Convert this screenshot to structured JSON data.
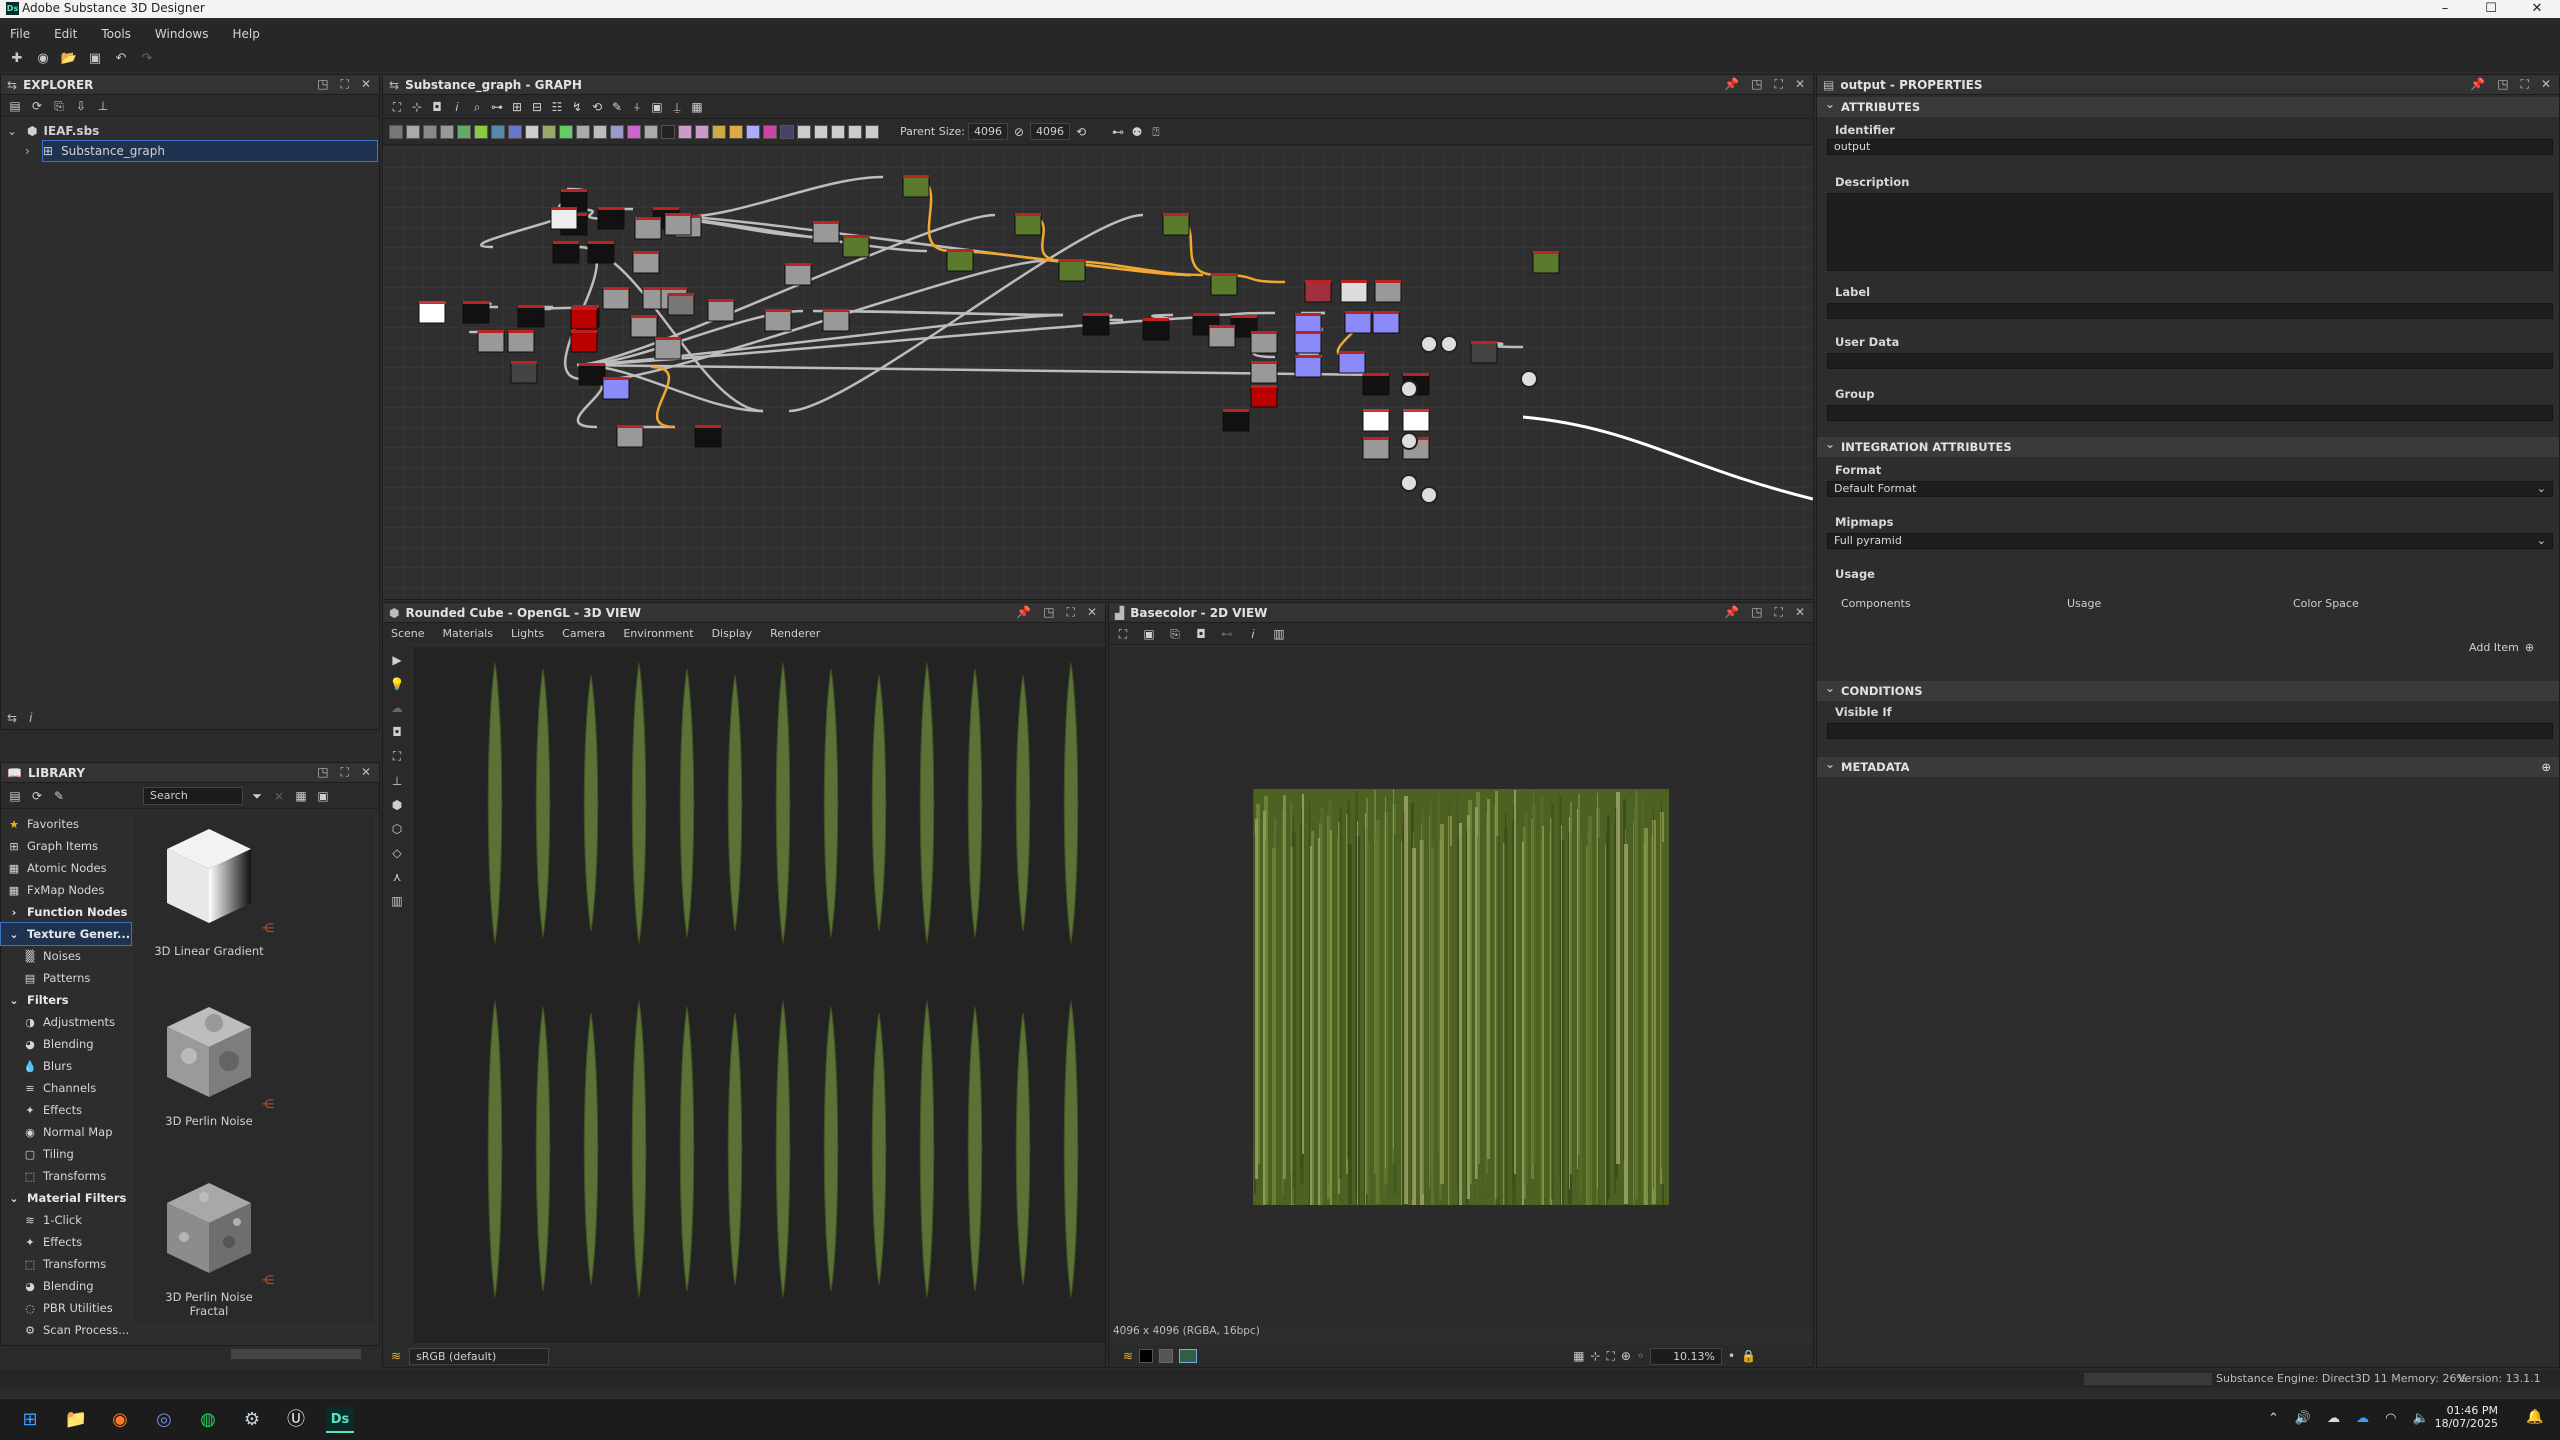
{
  "app": {
    "title": "Adobe Substance 3D Designer",
    "logo": "Ds"
  },
  "menu": [
    "File",
    "Edit",
    "Tools",
    "Windows",
    "Help"
  ],
  "explorer": {
    "title": "EXPLORER",
    "package": "IEAF.sbs",
    "graph": "Substance_graph"
  },
  "library": {
    "title": "LIBRARY",
    "search_placeholder": "Search",
    "categories": [
      {
        "label": "Favorites",
        "bold": false,
        "indent": 0,
        "icon": "star-icon"
      },
      {
        "label": "Graph Items",
        "bold": false,
        "indent": 0,
        "icon": "graph-icon"
      },
      {
        "label": "Atomic Nodes",
        "bold": false,
        "indent": 0,
        "icon": "grid-icon"
      },
      {
        "label": "FxMap Nodes",
        "bold": false,
        "indent": 0,
        "icon": "grid-icon"
      },
      {
        "label": "Function Nodes",
        "bold": true,
        "indent": 0,
        "icon": "chevron-right-icon"
      },
      {
        "label": "Texture Gener...",
        "bold": true,
        "indent": 0,
        "icon": "chevron-down-icon"
      },
      {
        "label": "Noises",
        "bold": false,
        "indent": 1,
        "icon": "noise-icon"
      },
      {
        "label": "Patterns",
        "bold": false,
        "indent": 1,
        "icon": "pattern-icon"
      },
      {
        "label": "Filters",
        "bold": true,
        "indent": 0,
        "icon": "chevron-down-icon"
      },
      {
        "label": "Adjustments",
        "bold": false,
        "indent": 1,
        "icon": "adjust-icon"
      },
      {
        "label": "Blending",
        "bold": false,
        "indent": 1,
        "icon": "blend-icon"
      },
      {
        "label": "Blurs",
        "bold": false,
        "indent": 1,
        "icon": "blur-icon"
      },
      {
        "label": "Channels",
        "bold": false,
        "indent": 1,
        "icon": "channels-icon"
      },
      {
        "label": "Effects",
        "bold": false,
        "indent": 1,
        "icon": "effects-icon"
      },
      {
        "label": "Normal Map",
        "bold": false,
        "indent": 1,
        "icon": "normal-icon"
      },
      {
        "label": "Tiling",
        "bold": false,
        "indent": 1,
        "icon": "tiling-icon"
      },
      {
        "label": "Transforms",
        "bold": false,
        "indent": 1,
        "icon": "transform-icon"
      },
      {
        "label": "Material Filters",
        "bold": true,
        "indent": 0,
        "icon": "chevron-down-icon"
      },
      {
        "label": "1-Click",
        "bold": false,
        "indent": 1,
        "icon": "click-icon"
      },
      {
        "label": "Effects",
        "bold": false,
        "indent": 1,
        "icon": "effects-icon"
      },
      {
        "label": "Transforms",
        "bold": false,
        "indent": 1,
        "icon": "transform-icon"
      },
      {
        "label": "Blending",
        "bold": false,
        "indent": 1,
        "icon": "blend-icon"
      },
      {
        "label": "PBR Utilities",
        "bold": false,
        "indent": 1,
        "icon": "pbr-icon"
      },
      {
        "label": "Scan Process...",
        "bold": false,
        "indent": 1,
        "icon": "scan-icon"
      }
    ],
    "items": [
      {
        "label": "3D Linear Gradient"
      },
      {
        "label": "3D Perlin Noise"
      },
      {
        "label": "3D Perlin Noise Fractal"
      }
    ]
  },
  "graph": {
    "title": "Substance_graph - GRAPH",
    "parent_size_label": "Parent Size:",
    "parent_size_value": "4096",
    "size_value": "4096"
  },
  "view3d": {
    "title": "Rounded Cube - OpenGL - 3D VIEW",
    "menu": [
      "Scene",
      "Materials",
      "Lights",
      "Camera",
      "Environment",
      "Display",
      "Renderer"
    ],
    "colorspace": "sRGB (default)"
  },
  "view2d": {
    "title": "Basecolor - 2D VIEW",
    "info": "4096 x 4096 (RGBA, 16bpc)",
    "zoom": "10.13%"
  },
  "properties": {
    "title": "output - PROPERTIES",
    "sections": {
      "attributes": "ATTRIBUTES",
      "integration": "INTEGRATION ATTRIBUTES",
      "conditions": "CONDITIONS",
      "metadata": "METADATA"
    },
    "identifier_label": "Identifier",
    "identifier_value": "output",
    "description_label": "Description",
    "label_label": "Label",
    "userdata_label": "User Data",
    "group_label": "Group",
    "format_label": "Format",
    "format_value": "Default Format",
    "mipmaps_label": "Mipmaps",
    "mipmaps_value": "Full pyramid",
    "usage_label": "Usage",
    "usage_cols": [
      "Components",
      "Usage",
      "Color Space"
    ],
    "add_item": "Add Item",
    "visible_if_label": "Visible If"
  },
  "status": {
    "engine": "Substance Engine: Direct3D 11  Memory: 26%",
    "version": "Version: 13.1.1"
  },
  "taskbar": {
    "time": "01:46 PM",
    "date": "18/07/2025"
  }
}
